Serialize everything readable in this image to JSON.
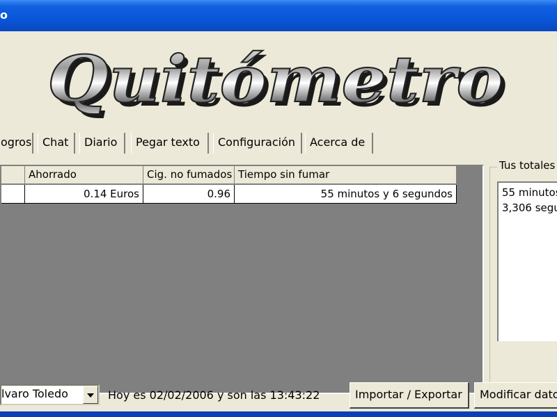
{
  "window": {
    "title": "o"
  },
  "app": {
    "logo_text": "Quitómetro"
  },
  "tabs": [
    {
      "label": "ogros"
    },
    {
      "label": "Chat"
    },
    {
      "label": "Diario"
    },
    {
      "label": "Pegar texto"
    },
    {
      "label": "Configuración"
    },
    {
      "label": "Acerca de"
    }
  ],
  "grid": {
    "columns": [
      "Ahorrado",
      "Cig. no fumados",
      "Tiempo sin fumar"
    ],
    "rows": [
      {
        "ahorrado": "0.14 Euros",
        "cig": "0.96",
        "tiempo": "55 minutos y 6 segundos"
      }
    ]
  },
  "totals": {
    "legend": "Tus totales",
    "lines": [
      "55 minutos",
      "3,306 segu"
    ]
  },
  "bottom": {
    "user": "lvaro Toledo",
    "date_text": "Hoy es 02/02/2006 y son las 13:43:22",
    "import_export": "Importar / Exportar",
    "modify": "Modificar datos"
  }
}
